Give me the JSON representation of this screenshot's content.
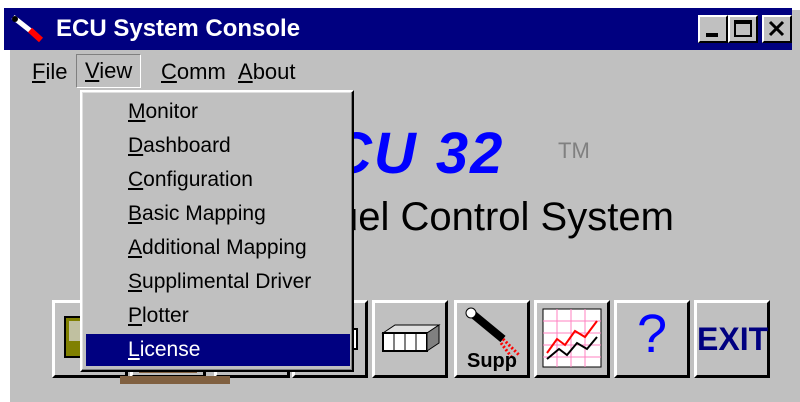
{
  "window": {
    "title": "ECU System Console",
    "title_bar_color": "#000080",
    "title_text_color": "#ffffff",
    "buttons": [
      "minimize-icon",
      "maximize-icon",
      "close-icon"
    ]
  },
  "menubar": {
    "items": [
      {
        "label_u": "F",
        "label_rest": "ile"
      },
      {
        "label_u": "V",
        "label_rest": "iew"
      },
      {
        "label_u": "C",
        "label_rest": "omm"
      },
      {
        "label_u": "A",
        "label_rest": "bout"
      }
    ],
    "open_menu": "View"
  },
  "view_menu": {
    "items": [
      {
        "label_u": "M",
        "label_rest": "onitor"
      },
      {
        "label_u": "D",
        "label_rest": "ashboard"
      },
      {
        "label_u": "C",
        "label_rest": "onfiguration"
      },
      {
        "label_u": "B",
        "label_rest": "asic Mapping"
      },
      {
        "label_u": "A",
        "label_rest": "dditional Mapping"
      },
      {
        "label_u": "S",
        "label_rest": "upplimental Driver"
      },
      {
        "label_u": "P",
        "label_rest": "lotter"
      },
      {
        "label_u": "L",
        "label_rest": "icense"
      }
    ],
    "selected_label": "License",
    "highlight_color": "#000080"
  },
  "main": {
    "logo_text": "CU 32",
    "tm": "TM",
    "subtitle": "uel Control System",
    "logo_color": "#0000ff"
  },
  "toolbar": {
    "buttons": [
      {
        "icon": "computer-icon"
      },
      {
        "icon": "panel-icon"
      },
      {
        "icon": "blocks-icon"
      },
      {
        "icon": "connector-icon"
      },
      {
        "icon": "supp-injector-icon",
        "label": "Supp"
      },
      {
        "icon": "plotter-chart-icon"
      },
      {
        "icon": "help-question-icon",
        "label": "?"
      },
      {
        "icon": "exit-icon",
        "label": "EXIT"
      }
    ]
  }
}
